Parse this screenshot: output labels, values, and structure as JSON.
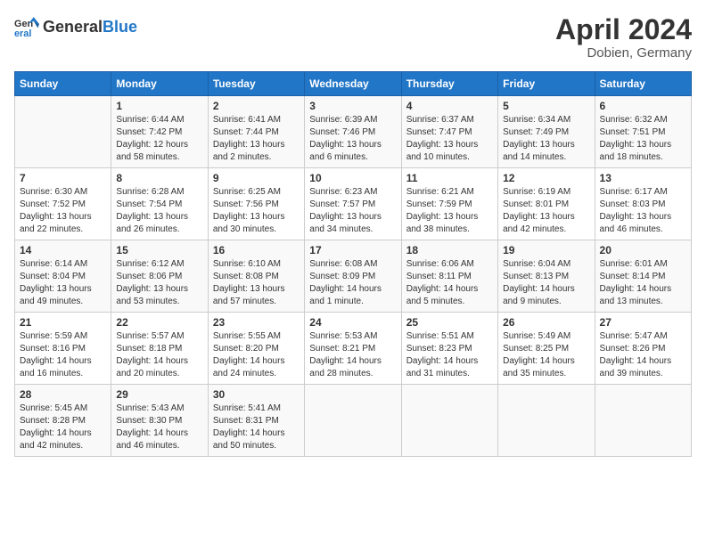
{
  "header": {
    "logo_general": "General",
    "logo_blue": "Blue",
    "month_title": "April 2024",
    "location": "Dobien, Germany"
  },
  "days_of_week": [
    "Sunday",
    "Monday",
    "Tuesday",
    "Wednesday",
    "Thursday",
    "Friday",
    "Saturday"
  ],
  "weeks": [
    [
      {
        "day": "",
        "content": ""
      },
      {
        "day": "1",
        "content": "Sunrise: 6:44 AM\nSunset: 7:42 PM\nDaylight: 12 hours\nand 58 minutes."
      },
      {
        "day": "2",
        "content": "Sunrise: 6:41 AM\nSunset: 7:44 PM\nDaylight: 13 hours\nand 2 minutes."
      },
      {
        "day": "3",
        "content": "Sunrise: 6:39 AM\nSunset: 7:46 PM\nDaylight: 13 hours\nand 6 minutes."
      },
      {
        "day": "4",
        "content": "Sunrise: 6:37 AM\nSunset: 7:47 PM\nDaylight: 13 hours\nand 10 minutes."
      },
      {
        "day": "5",
        "content": "Sunrise: 6:34 AM\nSunset: 7:49 PM\nDaylight: 13 hours\nand 14 minutes."
      },
      {
        "day": "6",
        "content": "Sunrise: 6:32 AM\nSunset: 7:51 PM\nDaylight: 13 hours\nand 18 minutes."
      }
    ],
    [
      {
        "day": "7",
        "content": "Sunrise: 6:30 AM\nSunset: 7:52 PM\nDaylight: 13 hours\nand 22 minutes."
      },
      {
        "day": "8",
        "content": "Sunrise: 6:28 AM\nSunset: 7:54 PM\nDaylight: 13 hours\nand 26 minutes."
      },
      {
        "day": "9",
        "content": "Sunrise: 6:25 AM\nSunset: 7:56 PM\nDaylight: 13 hours\nand 30 minutes."
      },
      {
        "day": "10",
        "content": "Sunrise: 6:23 AM\nSunset: 7:57 PM\nDaylight: 13 hours\nand 34 minutes."
      },
      {
        "day": "11",
        "content": "Sunrise: 6:21 AM\nSunset: 7:59 PM\nDaylight: 13 hours\nand 38 minutes."
      },
      {
        "day": "12",
        "content": "Sunrise: 6:19 AM\nSunset: 8:01 PM\nDaylight: 13 hours\nand 42 minutes."
      },
      {
        "day": "13",
        "content": "Sunrise: 6:17 AM\nSunset: 8:03 PM\nDaylight: 13 hours\nand 46 minutes."
      }
    ],
    [
      {
        "day": "14",
        "content": "Sunrise: 6:14 AM\nSunset: 8:04 PM\nDaylight: 13 hours\nand 49 minutes."
      },
      {
        "day": "15",
        "content": "Sunrise: 6:12 AM\nSunset: 8:06 PM\nDaylight: 13 hours\nand 53 minutes."
      },
      {
        "day": "16",
        "content": "Sunrise: 6:10 AM\nSunset: 8:08 PM\nDaylight: 13 hours\nand 57 minutes."
      },
      {
        "day": "17",
        "content": "Sunrise: 6:08 AM\nSunset: 8:09 PM\nDaylight: 14 hours\nand 1 minute."
      },
      {
        "day": "18",
        "content": "Sunrise: 6:06 AM\nSunset: 8:11 PM\nDaylight: 14 hours\nand 5 minutes."
      },
      {
        "day": "19",
        "content": "Sunrise: 6:04 AM\nSunset: 8:13 PM\nDaylight: 14 hours\nand 9 minutes."
      },
      {
        "day": "20",
        "content": "Sunrise: 6:01 AM\nSunset: 8:14 PM\nDaylight: 14 hours\nand 13 minutes."
      }
    ],
    [
      {
        "day": "21",
        "content": "Sunrise: 5:59 AM\nSunset: 8:16 PM\nDaylight: 14 hours\nand 16 minutes."
      },
      {
        "day": "22",
        "content": "Sunrise: 5:57 AM\nSunset: 8:18 PM\nDaylight: 14 hours\nand 20 minutes."
      },
      {
        "day": "23",
        "content": "Sunrise: 5:55 AM\nSunset: 8:20 PM\nDaylight: 14 hours\nand 24 minutes."
      },
      {
        "day": "24",
        "content": "Sunrise: 5:53 AM\nSunset: 8:21 PM\nDaylight: 14 hours\nand 28 minutes."
      },
      {
        "day": "25",
        "content": "Sunrise: 5:51 AM\nSunset: 8:23 PM\nDaylight: 14 hours\nand 31 minutes."
      },
      {
        "day": "26",
        "content": "Sunrise: 5:49 AM\nSunset: 8:25 PM\nDaylight: 14 hours\nand 35 minutes."
      },
      {
        "day": "27",
        "content": "Sunrise: 5:47 AM\nSunset: 8:26 PM\nDaylight: 14 hours\nand 39 minutes."
      }
    ],
    [
      {
        "day": "28",
        "content": "Sunrise: 5:45 AM\nSunset: 8:28 PM\nDaylight: 14 hours\nand 42 minutes."
      },
      {
        "day": "29",
        "content": "Sunrise: 5:43 AM\nSunset: 8:30 PM\nDaylight: 14 hours\nand 46 minutes."
      },
      {
        "day": "30",
        "content": "Sunrise: 5:41 AM\nSunset: 8:31 PM\nDaylight: 14 hours\nand 50 minutes."
      },
      {
        "day": "",
        "content": ""
      },
      {
        "day": "",
        "content": ""
      },
      {
        "day": "",
        "content": ""
      },
      {
        "day": "",
        "content": ""
      }
    ]
  ]
}
